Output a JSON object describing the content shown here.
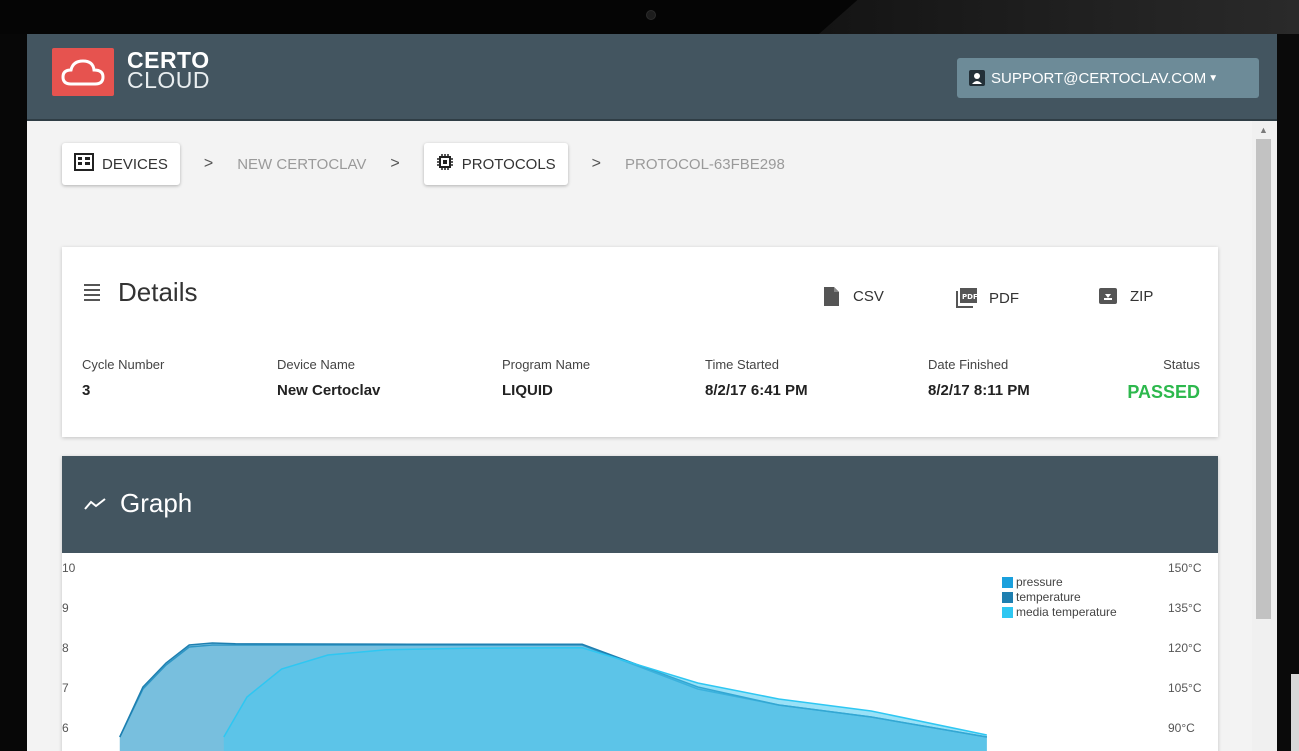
{
  "app": {
    "logo_line1": "CERTO",
    "logo_line2": "CLOUD",
    "user_label": "SUPPORT@CERTOCLAV.COM"
  },
  "breadcrumb": {
    "devices": "DEVICES",
    "device": "NEW CERTOCLAV",
    "protocols": "PROTOCOLS",
    "protocol": "PROTOCOL-63FBE298",
    "separator": ">"
  },
  "details": {
    "title": "Details",
    "downloads": {
      "csv": "CSV",
      "pdf": "PDF",
      "zip": "ZIP"
    },
    "fields": [
      {
        "label": "Cycle Number",
        "value": "3"
      },
      {
        "label": "Device Name",
        "value": "New Certoclav"
      },
      {
        "label": "Program Name",
        "value": "LIQUID"
      },
      {
        "label": "Time Started",
        "value": "8/2/17 6:41 PM"
      },
      {
        "label": "Date Finished",
        "value": "8/2/17 8:11 PM"
      },
      {
        "label": "Status",
        "value": "PASSED"
      }
    ]
  },
  "graph": {
    "title": "Graph"
  },
  "colors": {
    "navbar": "#435560",
    "logo": "#e6534f",
    "user_button": "#6d8b98",
    "passed": "#2db84d",
    "pressure": "#1aa0dd",
    "temperature": "#1e7fb0",
    "media_temperature": "#2ec7f2"
  },
  "chart_data": {
    "type": "area",
    "legend": [
      "pressure",
      "temperature",
      "media temperature"
    ],
    "legend_position": "top-right",
    "y_left_ticks": [
      "10",
      "9",
      "8",
      "7",
      "6"
    ],
    "y_right_ticks": [
      "150°C",
      "135°C",
      "120°C",
      "105°C",
      "90°C"
    ],
    "ylim_left": [
      5.8,
      10
    ],
    "series": [
      {
        "name": "pressure",
        "x": [
          0.05,
          0.07,
          0.09,
          0.11,
          0.13,
          0.15,
          0.3,
          0.45,
          0.55,
          0.62,
          0.7,
          0.8
        ],
        "values": [
          5.8,
          7.0,
          7.6,
          8.05,
          8.1,
          8.1,
          8.1,
          8.1,
          7.0,
          6.6,
          6.3,
          5.8
        ]
      },
      {
        "name": "temperature",
        "x": [
          0.05,
          0.07,
          0.09,
          0.11,
          0.13,
          0.15,
          0.3,
          0.45,
          0.55,
          0.62,
          0.7,
          0.8
        ],
        "values": [
          5.8,
          7.05,
          7.65,
          8.1,
          8.15,
          8.13,
          8.12,
          8.12,
          7.05,
          6.6,
          6.3,
          5.8
        ]
      },
      {
        "name": "media temperature",
        "x": [
          0.14,
          0.16,
          0.19,
          0.23,
          0.28,
          0.35,
          0.45,
          0.55,
          0.62,
          0.7,
          0.8
        ],
        "values": [
          5.8,
          6.8,
          7.5,
          7.85,
          7.98,
          8.02,
          8.03,
          7.15,
          6.75,
          6.45,
          5.85
        ]
      }
    ]
  }
}
